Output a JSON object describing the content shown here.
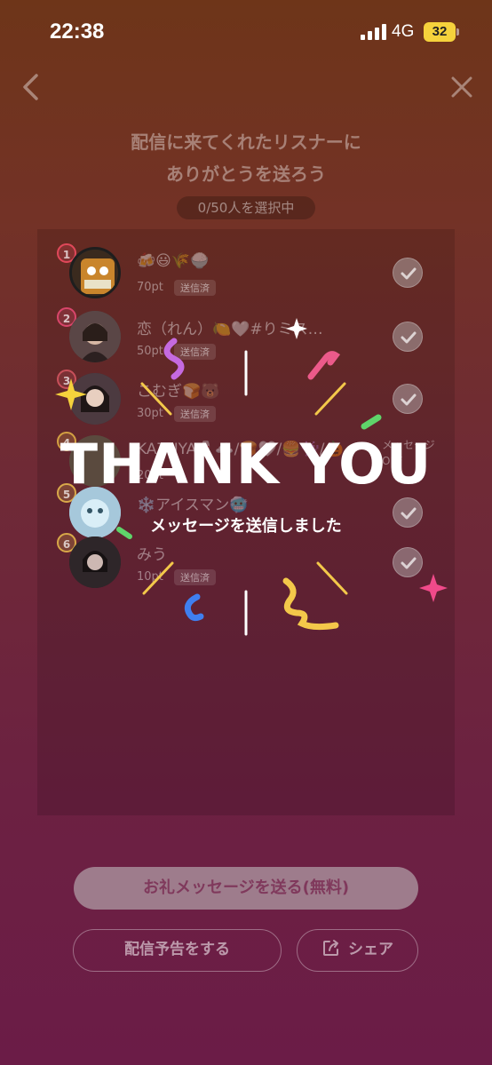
{
  "status": {
    "time": "22:38",
    "network": "4G",
    "battery": "32"
  },
  "header": {
    "title_line1": "配信に来てくれたリスナーに",
    "title_line2": "ありがとうを送ろう",
    "selection_counter": "0/50人を選択中"
  },
  "listeners": [
    {
      "rank": "1",
      "name": "🍻😃🌾🍚",
      "points": "70pt",
      "badge": "送信済"
    },
    {
      "rank": "2",
      "name": "恋（れん）🍋🤍#りミス…",
      "points": "50pt",
      "badge": "送信済"
    },
    {
      "rank": "3",
      "name": "こむぎ🍞🐻",
      "points": "30pt",
      "badge": "送信済"
    },
    {
      "rank": "4",
      "name": "KAZUYA🍷☁️/🍞🤍/🍔👾/🎃",
      "points": "20pt",
      "badge": "",
      "note": "メッセージOFF"
    },
    {
      "rank": "5",
      "name": "❄️アイスマン🥶",
      "points": "",
      "badge": ""
    },
    {
      "rank": "6",
      "name": "みう",
      "points": "10pt",
      "badge": "送信済"
    }
  ],
  "overlay": {
    "headline": "THANK YOU",
    "subtitle": "メッセージを送信しました"
  },
  "buttons": {
    "send_thanks": "お礼メッセージを送る(無料)",
    "schedule": "配信予告をする",
    "share": "シェア"
  },
  "colors": {
    "rank1": "#e0485a",
    "rank2": "#d9466b",
    "rank3": "#c8505a",
    "rank4": "#d3a042",
    "rank5": "#d9a94a",
    "rank6": "#d8a848"
  }
}
